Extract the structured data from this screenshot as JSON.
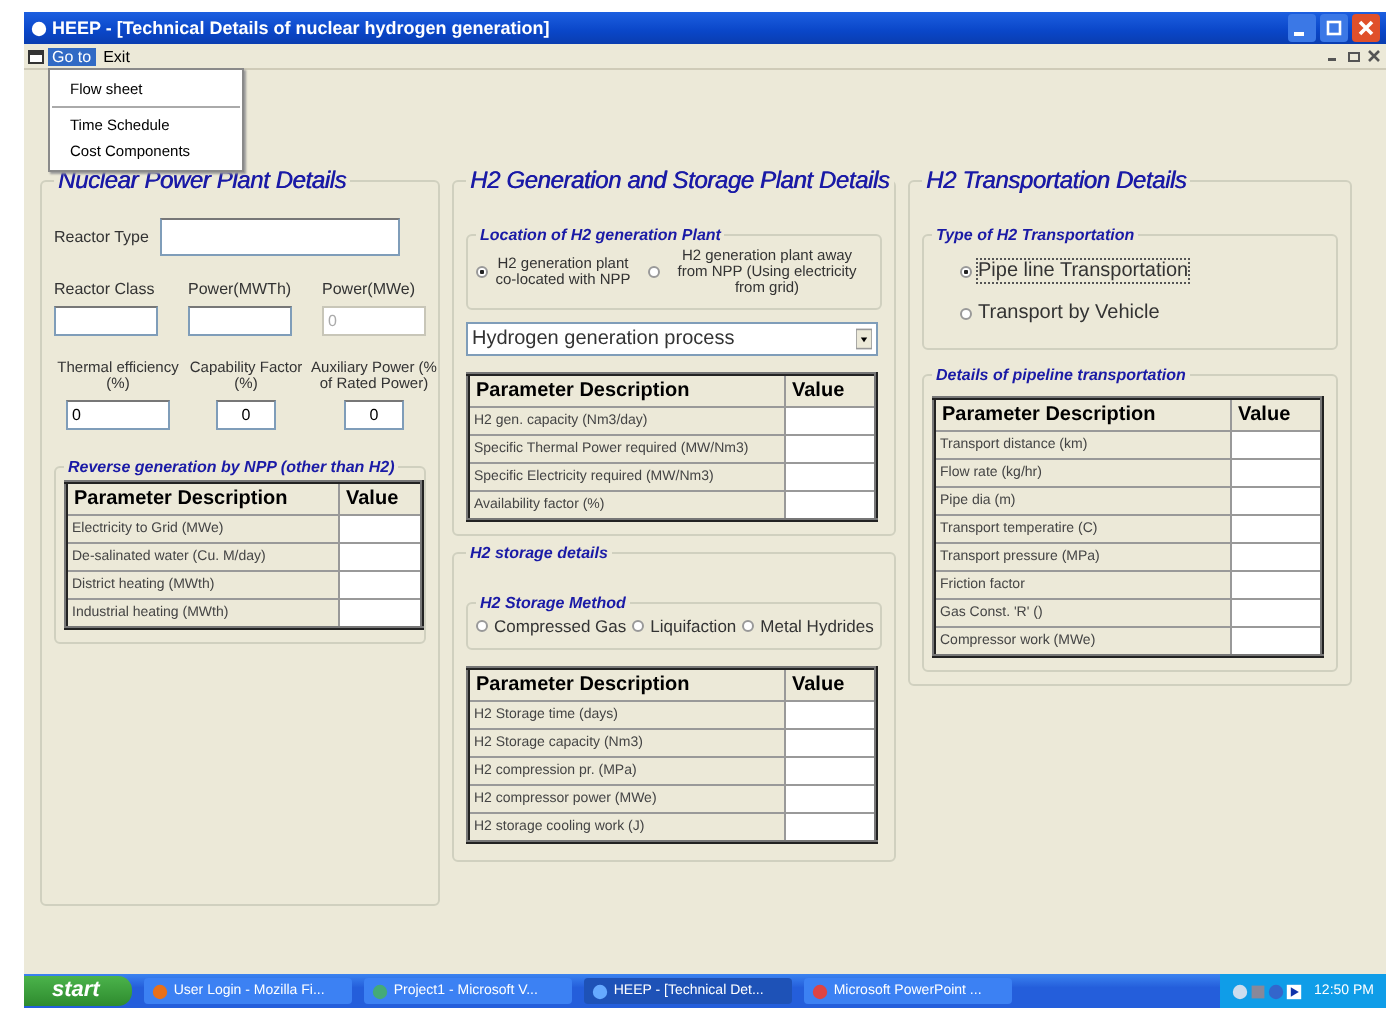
{
  "window": {
    "title": "HEEP - [Technical Details of nuclear hydrogen generation]"
  },
  "menu": [
    {
      "label": "Go to",
      "selected": true
    },
    {
      "label": "Exit",
      "selected": false
    }
  ],
  "dropdown_menu": [
    [
      "Flow sheet"
    ],
    [
      "Time Schedule",
      "Cost Components"
    ]
  ],
  "npp": {
    "title": "Nuclear Power Plant Details",
    "reactor_type_label": "Reactor Type",
    "fields_row_1": [
      {
        "label": "Reactor Class",
        "disabled": false
      },
      {
        "label": "Power(MWTh)",
        "disabled": false
      },
      {
        "label": "Power(MWe)",
        "value": "0",
        "disabled": true
      }
    ],
    "fields_row_2": [
      {
        "label": "Thermal efficiency (%)",
        "value": "0"
      },
      {
        "label": "Capability Factor (%)",
        "value": "0"
      },
      {
        "label": "Auxiliary Power (% of Rated Power)",
        "value": "0"
      }
    ],
    "revenue": {
      "title": "Reverse generation by NPP (other than H2)",
      "columns": [
        "Parameter Description",
        "Value"
      ],
      "rows": [
        "Electricity to Grid (MWe)",
        "De-salinated water (Cu. M/day)",
        "District heating (MWth)",
        "Industrial heating (MWth)"
      ]
    }
  },
  "h2": {
    "title": "H2 Generation and Storage Plant Details",
    "location_title": "Location of H2 generation Plant",
    "location_options": [
      {
        "label": "H2 generation plant co-located with NPP",
        "selected": true
      },
      {
        "label": "H2 generation plant away from NPP (Using electricity from grid)",
        "selected": false
      }
    ],
    "process_select": "Hydrogen generation process",
    "columns": [
      "Parameter Description",
      "Value"
    ],
    "rows": [
      "H2 gen. capacity (Nm3/day)",
      "Specific Thermal Power required (MW/Nm3)",
      "Specific Electricity required (MW/Nm3)",
      "Availability factor (%)"
    ],
    "storage_title": "H2 storage details",
    "method_title": "H2 Storage Method",
    "method_options": [
      {
        "label": "Compressed Gas",
        "selected": false
      },
      {
        "label": "Liquifaction",
        "selected": false
      },
      {
        "label": "Metal Hydrides",
        "selected": false
      }
    ],
    "storage_columns": [
      "Parameter Description",
      "Value"
    ],
    "storage_rows": [
      "H2 Storage time (days)",
      "H2 Storage capacity (Nm3)",
      "H2 compression pr. (MPa)",
      "H2 compressor power (MWe)",
      "H2 storage cooling work (J)"
    ]
  },
  "transport": {
    "title": "H2 Transportation Details",
    "type_title": "Type of H2 Transportation",
    "type_options": [
      {
        "label": "Pipe line Transportation",
        "selected": true
      },
      {
        "label": "Transport by Vehicle",
        "selected": false
      }
    ],
    "details_title": "Details of pipeline transportation",
    "columns": [
      "Parameter Description",
      "Value"
    ],
    "rows": [
      "Transport distance (km)",
      "Flow rate (kg/hr)",
      "Pipe dia (m)",
      "Transport temperatire (C)",
      "Transport pressure (MPa)",
      "Friction factor",
      "Gas Const. 'R' ()",
      "Compressor work (MWe)"
    ]
  },
  "taskbar": {
    "start": "start",
    "tasks": [
      {
        "label": "User Login - Mozilla Fi...",
        "selected": false
      },
      {
        "label": "Project1 - Microsoft V...",
        "selected": false
      },
      {
        "label": "HEEP - [Technical Det...",
        "selected": true
      },
      {
        "label": "Microsoft PowerPoint ...",
        "selected": false
      }
    ],
    "clock": "12:50 PM"
  }
}
